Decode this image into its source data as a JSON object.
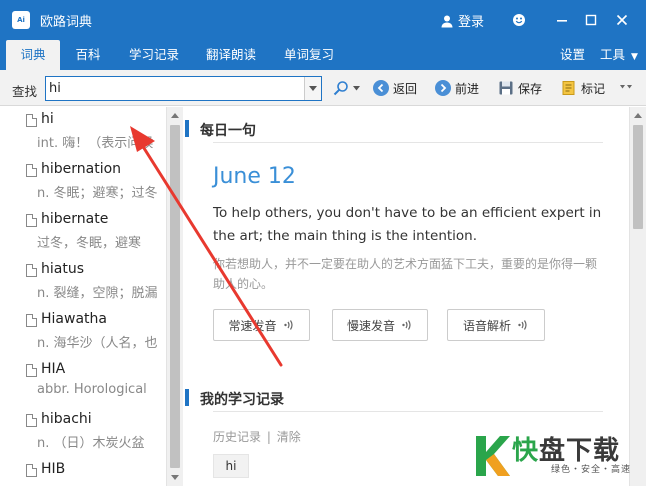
{
  "window": {
    "app_icon_text": "Ai",
    "title": "欧路词典",
    "login_label": "登录"
  },
  "menu": {
    "tabs": [
      "词典",
      "百科",
      "学习记录",
      "翻译朗读",
      "单词复习"
    ],
    "settings": "设置",
    "tools": "工具"
  },
  "search": {
    "label": "查找",
    "value": "hi",
    "back": "返回",
    "forward": "前进",
    "save": "保存",
    "mark": "标记"
  },
  "word_list": [
    {
      "word": "hi",
      "def": "int. 嗨！（表示问候"
    },
    {
      "word": "hibernation",
      "def": "n. 冬眠；避寒；过冬"
    },
    {
      "word": "hibernate",
      "def": "过冬，冬眠，避寒"
    },
    {
      "word": "hiatus",
      "def": "n. 裂缝，空隙；脱漏"
    },
    {
      "word": "Hiawatha",
      "def": "n. 海华沙（人名，也"
    },
    {
      "word": "HIA",
      "def": "abbr. Horological"
    },
    {
      "word": "hibachi",
      "def": "n. （日）木炭火盆"
    },
    {
      "word": "HIB",
      "def": ""
    }
  ],
  "daily": {
    "section_title": "每日一句",
    "date": "June 12",
    "english": "To help others, you don't have to be an efficient expert in the art; the main thing is the intention.",
    "chinese": "你若想助人，并不一定要在助人的艺术方面猛下工夫，重要的是你得一颗助人的心。",
    "buttons": [
      "常速发音",
      "慢速发音",
      "语音解析"
    ]
  },
  "study": {
    "section_title": "我的学习记录",
    "history_label": "历史记录",
    "separator": "|",
    "clear_label": "清除",
    "history_items": [
      "hi"
    ]
  },
  "watermark": {
    "brand_green": "快",
    "brand_rest": "盘下载",
    "slogan": "绿色・安全・高速"
  },
  "colors": {
    "title_bar": "#1f74c4",
    "accent_blue": "#3a8fd7",
    "annotation_red": "#e8392f",
    "watermark_green": "#2aa54b"
  },
  "icons": [
    "user-icon",
    "smiley-icon",
    "minimize-icon",
    "maximize-icon",
    "close-icon",
    "search-icon",
    "back-icon",
    "forward-icon",
    "save-icon",
    "mark-icon",
    "speaker-icon",
    "document-icon"
  ]
}
